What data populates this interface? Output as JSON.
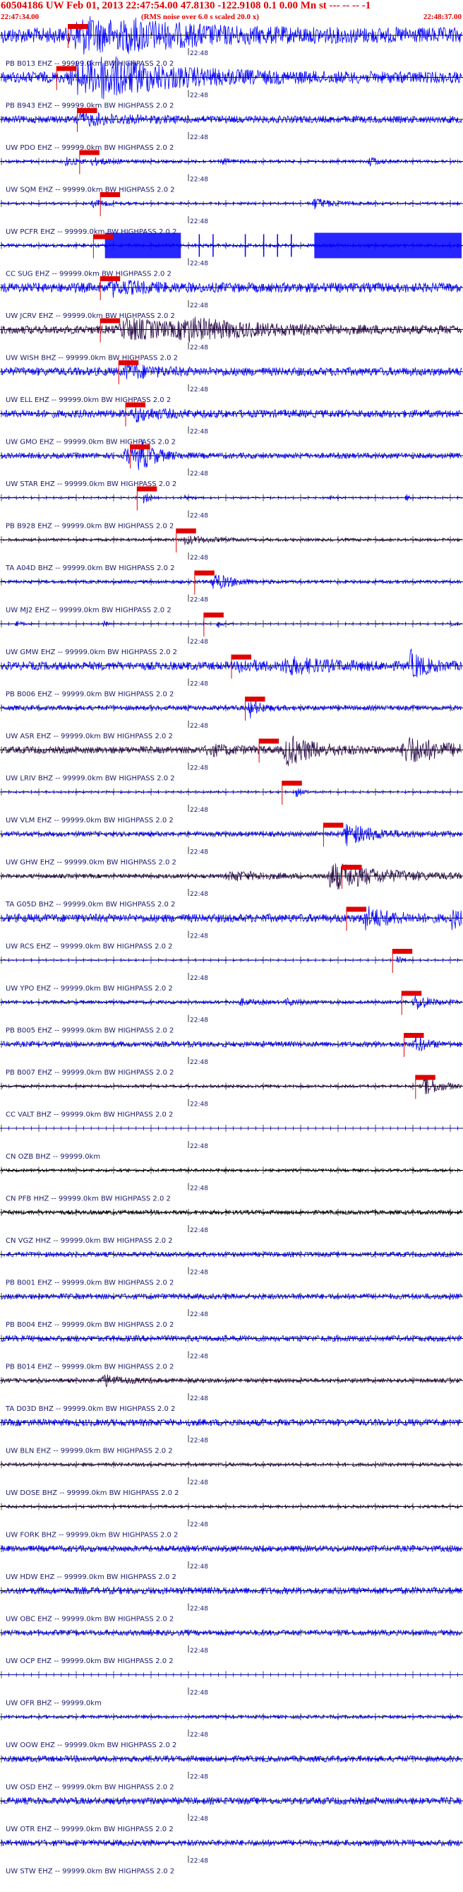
{
  "header": {
    "title": "60504186 UW Feb 01, 2013 22:47:54.00   47.8130 -122.9108  0.1 0.00 Mn st --- -- --  -1",
    "start_time": "22:47:34.00",
    "rms_note": "(RMS noise over 6.0 s scaled 20.0 x)",
    "end_time": "22:48:37.00"
  },
  "time_mark": "22:48",
  "colors": {
    "header_red": "#e00000",
    "trace_blue": "#0000ff",
    "trace_dark": "#2a0a4a",
    "trace_black": "#000000",
    "pick_red": "#e00000",
    "label_ink": "#1a1a6e"
  },
  "traces": [
    {
      "label": "PB B013 EHZ -- 99999.0km BW  HIGHPASS  2.0  2",
      "color": "blue",
      "amp": 0.55,
      "pick": 0.145,
      "bursts": [
        [
          0.17,
          0.95,
          0.16
        ],
        [
          0.28,
          0.35,
          0.12
        ]
      ]
    },
    {
      "label": "PB B943 EHZ -- 99999.0km BW  HIGHPASS  2.0  2",
      "color": "blue",
      "amp": 0.4,
      "pick": 0.12,
      "bursts": [
        [
          0.17,
          1.0,
          0.18
        ],
        [
          0.22,
          0.6,
          0.1
        ]
      ]
    },
    {
      "label": "UW PDO EHZ -- 99999.0km BW  HIGHPASS  2.0  2",
      "color": "blue",
      "amp": 0.25,
      "pick": 0.165,
      "bursts": [
        [
          0.17,
          0.35,
          0.1
        ]
      ]
    },
    {
      "label": "UW SQM EHZ -- 99999.0km BW  HIGHPASS  2.0  2",
      "color": "blue",
      "amp": 0.1,
      "pick": 0.17,
      "bursts": [
        [
          0.14,
          0.25,
          0.03
        ],
        [
          0.2,
          0.2,
          0.05
        ],
        [
          0.48,
          0.15,
          0.03
        ],
        [
          0.8,
          0.3,
          0.02
        ]
      ]
    },
    {
      "label": "UW PCFR EHZ -- 99999.0km BW  HIGHPASS  2.0  2",
      "color": "blue",
      "amp": 0.08,
      "pick": 0.215,
      "bursts": [
        [
          0.68,
          0.4,
          0.04
        ],
        [
          0.2,
          0.25,
          0.03
        ]
      ]
    },
    {
      "label": "CC SUG EHZ -- 99999.0km BW  HIGHPASS  2.0  2",
      "color": "blue",
      "amp": 0.12,
      "pick": 0.2,
      "bursts": [],
      "saturated": [
        [
          0.225,
          0.39
        ],
        [
          0.68,
          1.0
        ]
      ],
      "spikes": [
        0.43,
        0.46,
        0.53,
        0.57,
        0.6,
        0.63
      ]
    },
    {
      "label": "UW JCRV EHZ -- 99999.0km BW  HIGHPASS  2.0  2",
      "color": "blue",
      "amp": 0.35,
      "pick": 0.215,
      "bursts": [
        [
          0.24,
          0.4,
          0.06
        ]
      ]
    },
    {
      "label": "UW WISH BHZ -- 99999.0km BW  HIGHPASS  2.0  2",
      "color": "dark",
      "amp": 0.3,
      "pick": 0.215,
      "bursts": [
        [
          0.27,
          0.65,
          0.12
        ],
        [
          0.4,
          0.5,
          0.15
        ]
      ]
    },
    {
      "label": "UW ELL EHZ -- 99999.0km BW  HIGHPASS  2.0  2",
      "color": "blue",
      "amp": 0.3,
      "pick": 0.255,
      "bursts": [
        [
          0.27,
          0.5,
          0.05
        ]
      ]
    },
    {
      "label": "UW GMO EHZ -- 99999.0km BW  HIGHPASS  2.0  2",
      "color": "blue",
      "amp": 0.28,
      "pick": 0.27,
      "bursts": [
        [
          0.29,
          0.4,
          0.05
        ]
      ]
    },
    {
      "label": "UW STAR EHZ -- 99999.0km BW  HIGHPASS  2.0  2",
      "color": "blue",
      "amp": 0.2,
      "pick": 0.28,
      "bursts": [
        [
          0.3,
          1.0,
          0.03
        ],
        [
          0.27,
          0.5,
          0.03
        ]
      ]
    },
    {
      "label": "PB B928 EHZ -- 99999.0km BW  HIGHPASS  2.0  2",
      "color": "blue",
      "amp": 0.05,
      "pick": 0.295,
      "bursts": [
        [
          0.31,
          0.45,
          0.01
        ],
        [
          0.4,
          0.3,
          0.01
        ],
        [
          0.71,
          0.2,
          0.01
        ],
        [
          0.88,
          0.25,
          0.01
        ]
      ]
    },
    {
      "label": "TA A04D BHZ -- 99999.0km BW  HIGHPASS  2.0  2",
      "color": "dark",
      "amp": 0.1,
      "pick": 0.38,
      "bursts": [
        [
          0.4,
          0.3,
          0.05
        ]
      ]
    },
    {
      "label": "UW MJ2 EHZ -- 99999.0km BW  HIGHPASS  2.0  2",
      "color": "blue",
      "amp": 0.12,
      "pick": 0.42,
      "bursts": [
        [
          0.46,
          0.6,
          0.04
        ]
      ]
    },
    {
      "label": "UW GMW EHZ -- 99999.0km BW  HIGHPASS  2.0  2",
      "color": "blue",
      "amp": 0.04,
      "pick": 0.44,
      "bursts": [
        [
          0.03,
          0.3,
          0.01
        ],
        [
          0.22,
          0.25,
          0.01
        ],
        [
          0.47,
          0.3,
          0.01
        ],
        [
          0.97,
          0.3,
          0.01
        ]
      ]
    },
    {
      "label": "PB B006 EHZ -- 99999.0km BW  HIGHPASS  2.0  2",
      "color": "blue",
      "amp": 0.3,
      "pick": 0.5,
      "bursts": [
        [
          0.62,
          0.45,
          0.1
        ],
        [
          0.89,
          0.9,
          0.03
        ],
        [
          0.52,
          0.35,
          0.04
        ]
      ]
    },
    {
      "label": "UW ASR EHZ -- 99999.0km BW  HIGHPASS  2.0  2",
      "color": "blue",
      "amp": 0.18,
      "pick": 0.53,
      "bursts": [
        [
          0.54,
          0.6,
          0.02
        ]
      ]
    },
    {
      "label": "UW LRIV BHZ -- 99999.0km BW  HIGHPASS  2.0  2",
      "color": "dark",
      "amp": 0.25,
      "pick": 0.56,
      "bursts": [
        [
          0.62,
          1.0,
          0.06
        ],
        [
          0.88,
          0.9,
          0.08
        ],
        [
          0.45,
          0.3,
          0.06
        ]
      ]
    },
    {
      "label": "UW VLM EHZ -- 99999.0km BW  HIGHPASS  2.0  2",
      "color": "blue",
      "amp": 0.06,
      "pick": 0.61,
      "bursts": [
        [
          0.64,
          0.45,
          0.01
        ]
      ]
    },
    {
      "label": "UW GHW EHZ -- 99999.0km BW  HIGHPASS  2.0  2",
      "color": "blue",
      "amp": 0.18,
      "pick": 0.7,
      "bursts": [
        [
          0.75,
          0.7,
          0.06
        ]
      ]
    },
    {
      "label": "TA G05D BHZ -- 99999.0km BW  HIGHPASS  2.0  2",
      "color": "dark",
      "amp": 0.15,
      "pick": 0.74,
      "bursts": [
        [
          0.72,
          0.9,
          0.12
        ],
        [
          0.5,
          0.3,
          0.08
        ]
      ]
    },
    {
      "label": "UW RCS EHZ -- 99999.0km BW  HIGHPASS  2.0  2",
      "color": "blue",
      "amp": 0.3,
      "pick": 0.75,
      "bursts": [
        [
          0.79,
          0.7,
          0.05
        ],
        [
          0.98,
          0.6,
          0.02
        ]
      ]
    },
    {
      "label": "UW YPO EHZ -- 99999.0km BW  HIGHPASS  2.0  2",
      "color": "blue",
      "amp": 0.04,
      "pick": 0.85,
      "bursts": [
        [
          0.86,
          0.35,
          0.01
        ]
      ]
    },
    {
      "label": "PB B005 EHZ -- 99999.0km BW  HIGHPASS  2.0  2",
      "color": "blue",
      "amp": 0.12,
      "pick": 0.87,
      "bursts": [
        [
          0.9,
          0.55,
          0.03
        ],
        [
          0.52,
          0.2,
          0.03
        ],
        [
          0.62,
          0.2,
          0.03
        ]
      ]
    },
    {
      "label": "PB B007 EHZ -- 99999.0km BW  HIGHPASS  2.0  2",
      "color": "blue",
      "amp": 0.2,
      "pick": 0.875,
      "bursts": [
        [
          0.9,
          0.6,
          0.02
        ]
      ]
    },
    {
      "label": "CC VALT BHZ -- 99999.0km BW  HIGHPASS  2.0  2",
      "color": "dark",
      "amp": 0.1,
      "pick": 0.9,
      "bursts": [
        [
          0.92,
          0.8,
          0.03
        ]
      ]
    },
    {
      "label": "CN OZB BHZ -- 99999.0km",
      "color": "blue",
      "amp": 0.01,
      "pick": null,
      "bursts": []
    },
    {
      "label": "CN PFB HHZ -- 99999.0km BW  HIGHPASS  2.0  2",
      "color": "black",
      "amp": 0.1,
      "pick": null,
      "bursts": []
    },
    {
      "label": "CN VGZ HHZ -- 99999.0km BW  HIGHPASS  2.0  2",
      "color": "black",
      "amp": 0.15,
      "pick": null,
      "bursts": []
    },
    {
      "label": "PB B001 EHZ -- 99999.0km BW  HIGHPASS  2.0  2",
      "color": "blue",
      "amp": 0.18,
      "pick": null,
      "bursts": []
    },
    {
      "label": "PB B004 EHZ -- 99999.0km BW  HIGHPASS  2.0  2",
      "color": "blue",
      "amp": 0.2,
      "pick": null,
      "bursts": []
    },
    {
      "label": "PB B014 EHZ -- 99999.0km BW  HIGHPASS  2.0  2",
      "color": "blue",
      "amp": 0.22,
      "pick": null,
      "bursts": []
    },
    {
      "label": "TA D03D BHZ -- 99999.0km BW  HIGHPASS  2.0  2",
      "color": "dark",
      "amp": 0.15,
      "pick": null,
      "bursts": [
        [
          0.22,
          0.4,
          0.04
        ]
      ]
    },
    {
      "label": "UW BLN EHZ -- 99999.0km BW  HIGHPASS  2.0  2",
      "color": "blue",
      "amp": 0.25,
      "pick": null,
      "bursts": []
    },
    {
      "label": "UW DOSE BHZ -- 99999.0km BW  HIGHPASS  2.0  2",
      "color": "dark",
      "amp": 0.12,
      "pick": null,
      "bursts": []
    },
    {
      "label": "UW FORK BHZ -- 99999.0km BW  HIGHPASS  2.0  2",
      "color": "dark",
      "amp": 0.1,
      "pick": null,
      "bursts": []
    },
    {
      "label": "UW HDW EHZ -- 99999.0km BW  HIGHPASS  2.0  2",
      "color": "blue",
      "amp": 0.22,
      "pick": null,
      "bursts": []
    },
    {
      "label": "UW OBC EHZ -- 99999.0km BW  HIGHPASS  2.0  2",
      "color": "blue",
      "amp": 0.25,
      "pick": null,
      "bursts": []
    },
    {
      "label": "UW OCP EHZ -- 99999.0km BW  HIGHPASS  2.0  2",
      "color": "blue",
      "amp": 0.2,
      "pick": null,
      "bursts": []
    },
    {
      "label": "UW OFR BHZ -- 99999.0km",
      "color": "blue",
      "amp": 0.01,
      "pick": null,
      "bursts": []
    },
    {
      "label": "UW OOW EHZ -- 99999.0km BW  HIGHPASS  2.0  2",
      "color": "blue",
      "amp": 0.12,
      "pick": null,
      "bursts": []
    },
    {
      "label": "UW OSD EHZ -- 99999.0km BW  HIGHPASS  2.0  2",
      "color": "blue",
      "amp": 0.22,
      "pick": null,
      "bursts": []
    },
    {
      "label": "UW OTR EHZ -- 99999.0km BW  HIGHPASS  2.0  2",
      "color": "blue",
      "amp": 0.25,
      "pick": null,
      "bursts": []
    },
    {
      "label": "UW STW EHZ -- 99999.0km BW  HIGHPASS  2.0  2",
      "color": "blue",
      "amp": 0.22,
      "pick": null,
      "bursts": []
    }
  ]
}
